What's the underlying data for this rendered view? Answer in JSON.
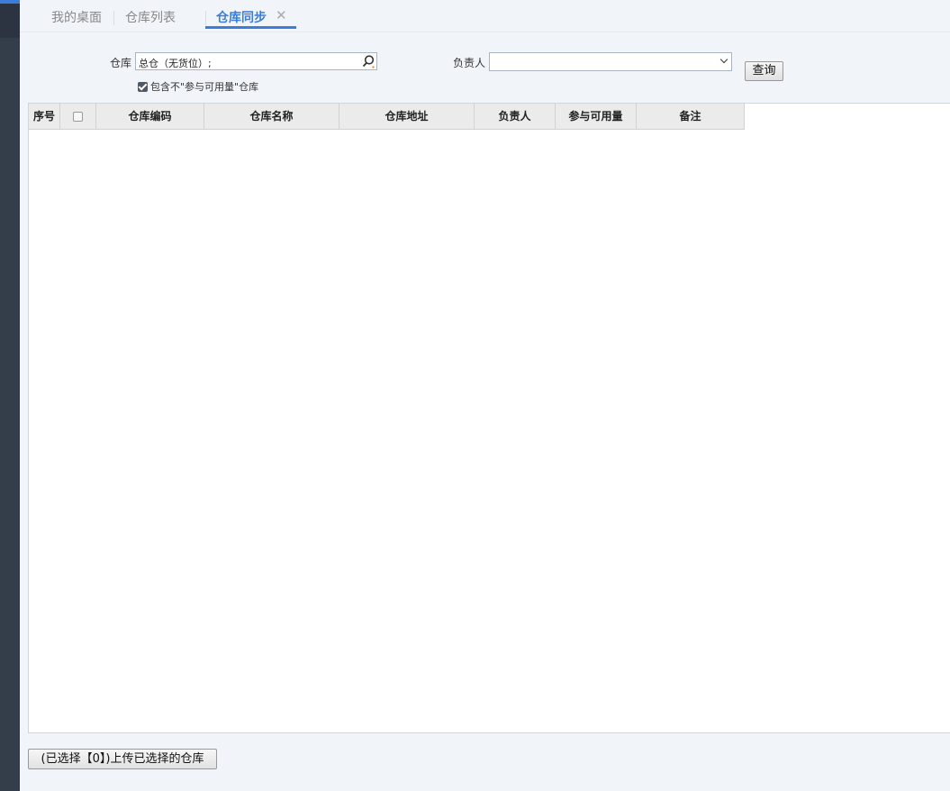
{
  "tabs": [
    {
      "label": "我的桌面"
    },
    {
      "label": "仓库列表"
    },
    {
      "label": "仓库同步"
    }
  ],
  "form": {
    "warehouse_label": "仓库",
    "warehouse_value": "总仓（无货位）;",
    "include_checkbox_label": "包含不\"参与可用量\"仓库",
    "include_checked": true,
    "owner_label": "负责人",
    "owner_value": "",
    "query_label": "查询"
  },
  "table": {
    "columns": [
      "序号",
      "",
      "仓库编码",
      "仓库名称",
      "仓库地址",
      "负责人",
      "参与可用量",
      "备注"
    ],
    "rows": []
  },
  "footer": {
    "upload_label": "(已选择【0】)上传已选择的仓库"
  },
  "colors": {
    "accent": "#3b7dd8",
    "sidebar": "#343e4b",
    "background": "#f1f5fa"
  }
}
